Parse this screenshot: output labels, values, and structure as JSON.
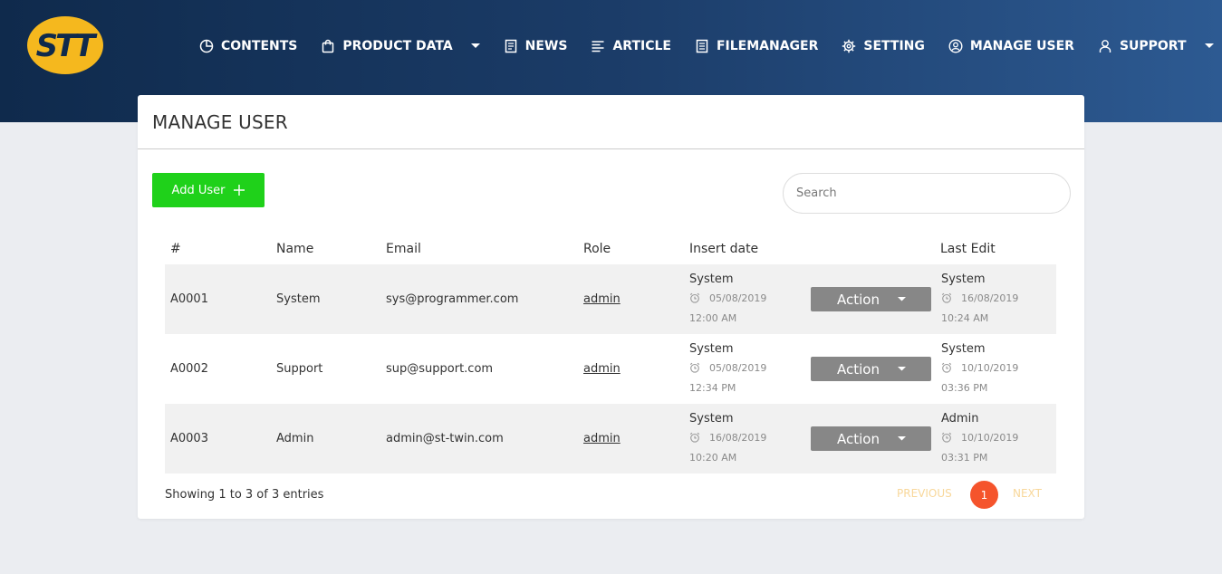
{
  "brand": {
    "logo_text": "STT"
  },
  "nav": {
    "contents": "CONTENTS",
    "product_data": "PRODUCT DATA",
    "news": "NEWS",
    "article": "ARTICLE",
    "filemanager": "FILEMANAGER",
    "setting": "SETTING",
    "manage_user": "MANAGE USER",
    "support": "SUPPORT"
  },
  "page": {
    "title": "MANAGE USER"
  },
  "toolbar": {
    "add_user_label": "Add User",
    "search_placeholder": "Search"
  },
  "table": {
    "headers": {
      "id": "#",
      "name": "Name",
      "email": "Email",
      "role": "Role",
      "insert_date": "Insert date",
      "last_edit": "Last Edit"
    },
    "action_label": "Action",
    "rows": [
      {
        "id": "A0001",
        "name": "System",
        "email": "sys@programmer.com",
        "role": "admin",
        "insert_by": "System",
        "insert_date": "05/08/2019 12:00 AM",
        "edit_by": "System",
        "edit_date": "16/08/2019 10:24 AM"
      },
      {
        "id": "A0002",
        "name": "Support",
        "email": "sup@support.com",
        "role": "admin",
        "insert_by": "System",
        "insert_date": "05/08/2019 12:34 PM",
        "edit_by": "System",
        "edit_date": "10/10/2019 03:36 PM"
      },
      {
        "id": "A0003",
        "name": "Admin",
        "email": "admin@st-twin.com",
        "role": "admin",
        "insert_by": "System",
        "insert_date": "16/08/2019 10:20 AM",
        "edit_by": "Admin",
        "edit_date": "10/10/2019 03:31 PM"
      }
    ]
  },
  "footer": {
    "info": "Showing 1 to 3 of 3 entries",
    "previous": "PREVIOUS",
    "current_page": "1",
    "next": "NEXT"
  },
  "colors": {
    "add_button": "#1fd11a",
    "active_page": "#f5542c",
    "logo_yellow": "#f5b81e",
    "header_dark": "#0f2a4c"
  }
}
